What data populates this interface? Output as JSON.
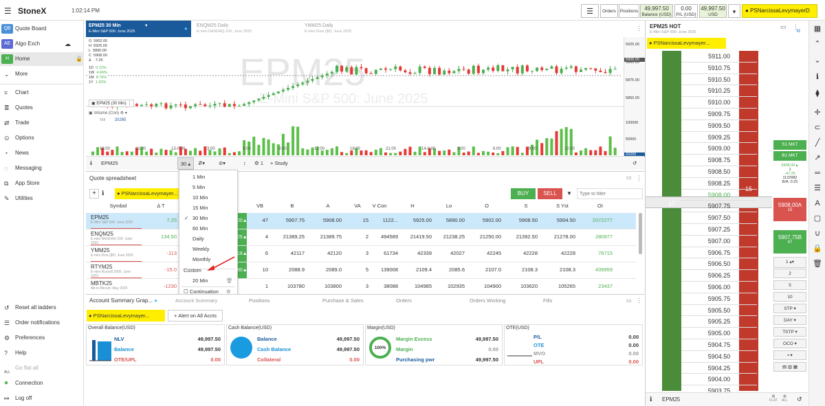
{
  "app": {
    "menu_icon": "hamburger-icon",
    "logo": "StoneX",
    "clock": "1:02:14 PM"
  },
  "account_bar": {
    "orders": "Orders",
    "positions": "Positions",
    "balance_value": "49,997.50",
    "balance_label": "Balance (USD)",
    "pl_value": "0.00",
    "pl_label": "P/L (USD)",
    "usd_value": "49,997.50",
    "usd_label": "USD",
    "account": "PSNarcissaLevymayerD"
  },
  "sidebar": {
    "items": [
      {
        "abbr": "QB",
        "label": "Quote Board",
        "color": "#4a90d9"
      },
      {
        "abbr": "AE",
        "label": "Algo Exch",
        "color": "#5b6bd6"
      },
      {
        "abbr": "H",
        "label": "Home",
        "color": "#4caf50"
      }
    ],
    "more": "More",
    "nav": [
      "Chart",
      "Quotes",
      "Trade",
      "Options",
      "News",
      "Messaging",
      "App Store",
      "Utilities"
    ],
    "bottom": [
      "Reset all ladders",
      "Order notifications",
      "Preferences",
      "Help",
      "Go flat all",
      "Connection",
      "Log off"
    ],
    "all_label": "ALL"
  },
  "chart": {
    "tabs": [
      {
        "title": "EPM25 30 Min",
        "sub": "E-Mini S&P 500: June 2025"
      },
      {
        "title": "ENQM25 Daily",
        "sub": "E-mini NASDAQ-100: June 2025"
      },
      {
        "title": "YMM25 Daily",
        "sub": "E-mini Dow ($5): June 2025"
      }
    ],
    "watermark": "EPM25",
    "watermark_sub": "E-Mini S&P 500: June 2025",
    "ohlc": {
      "O": "5902.00",
      "H": "5925.00",
      "L": "5890.00",
      "C": "5908.00",
      "chg": "7.25"
    },
    "perf": [
      {
        "k": "1D",
        "v": "0.12%"
      },
      {
        "k": "1W",
        "v": "4.66%"
      },
      {
        "k": "1M",
        "v": "8.76%"
      },
      {
        "k": "1Y",
        "v": "1.92%"
      }
    ],
    "series_label": "EPM25 (30 Min)",
    "vol_label": "Volume (Con)",
    "vol_key": "Vol",
    "vol_value": "20265",
    "price_axis": [
      "5925.00",
      "5900.00",
      "5875.00",
      "5850.00"
    ],
    "price_tag": "5908.00",
    "vol_axis": [
      "100000",
      "50000"
    ],
    "vol_tag": "20265",
    "time_axis": [
      "18:00",
      "21:00",
      "13-0:00",
      "3:00",
      "6:00",
      "9:00",
      "12:00",
      "18:00",
      "21:00",
      "14-0:00",
      "3:00",
      "6:00",
      "9:00",
      "12:00"
    ],
    "toolbar": {
      "symbol": "EPM25",
      "interval": "30",
      "study": "+ Study",
      "settings_num": "1"
    }
  },
  "quote": {
    "title": "Quote spreadsheet",
    "account": "PSNarcissaLevymayer...",
    "buy": "BUY",
    "sell": "SELL",
    "filter_placeholder": "Type to filter",
    "columns": [
      "Symbol",
      "Δ T",
      "VB",
      "B",
      "A",
      "VA",
      "V Con",
      "H",
      "Lo",
      "O",
      "S",
      "S Yst",
      "OI"
    ],
    "rows": [
      {
        "sym": "EPM25",
        "desc": "E-Mini S&P 500: June 2025",
        "dt": "7.25",
        "vb": "47",
        "b": "5907.75",
        "a": "5908.00",
        "va": "15",
        "vcon": "1122...",
        "h": "5925.00",
        "lo": "5890.00",
        "o": "5902.00",
        "s": "5908.50",
        "syst": "5904.50",
        "oi": "2072277",
        "green": "00▲"
      },
      {
        "sym": "ENQM25",
        "desc": "E-mini NASDAQ-100: June 2025",
        "dt": "134.50",
        "vb": "4",
        "b": "21389.25",
        "a": "21389.75",
        "va": "2",
        "vcon": "494589",
        "h": "21419.50",
        "lo": "21238.25",
        "o": "21250.00",
        "s": "21392.50",
        "syst": "21278.00",
        "oi": "280977",
        "green": "25▲"
      },
      {
        "sym": "YMM25",
        "desc": "E-mini Dow ($5): June 2025",
        "dt": "-113",
        "vb": "6",
        "b": "42117",
        "a": "42120",
        "va": "3",
        "vcon": "61734",
        "h": "42339",
        "lo": "42027",
        "o": "42245",
        "s": "42228",
        "syst": "42228",
        "oi": "76715",
        "green": "18▲"
      },
      {
        "sym": "RTYM25",
        "desc": "E-mini Russell 2000: June 2025",
        "dt": "-15.0",
        "vb": "10",
        "b": "2088.9",
        "a": "2089.0",
        "va": "5",
        "vcon": "139008",
        "h": "2109.4",
        "lo": "2085.6",
        "o": "2107.0",
        "s": "2108.3",
        "syst": "2108.3",
        "oi": "439959",
        "green": "80▲"
      },
      {
        "sym": "MBTK25",
        "desc": "Micro Bitcoin: May 2025",
        "dt": "-1230",
        "vb": "1",
        "b": "103780",
        "a": "103800",
        "va": "3",
        "vcon": "38088",
        "h": "104985",
        "lo": "102935",
        "o": "104900",
        "s": "103620",
        "syst": "105265",
        "oi": "23437",
        "green": ""
      }
    ]
  },
  "dropdown": {
    "items": [
      "1 Min",
      "5 Min",
      "10 Min",
      "15 Min",
      "30 Min",
      "60 Min",
      "Daily",
      "Weekly",
      "Monthly"
    ],
    "checked": "30 Min",
    "custom": "Custom",
    "custom_item": "20 Min",
    "continuation": "Continuation"
  },
  "account_summary": {
    "title": "Account Summary Grap...",
    "tabs": [
      "Account Summary",
      "Positions",
      "Purchase & Sales",
      "Orders",
      "Orders Working",
      "Fills"
    ],
    "account": "PSNarcissaLevymayer...",
    "alert": "+ Alert on All Accts",
    "cards": [
      {
        "title": "Overall Balance(USD)",
        "rows": [
          {
            "l": "NLV",
            "v": "49,997.50"
          },
          {
            "l": "Balance",
            "v": "49,997.50"
          },
          {
            "l": "OTE/UPL",
            "v": "0.00"
          }
        ]
      },
      {
        "title": "Cash Balance(USD)",
        "rows": [
          {
            "l": "Balance",
            "v": "49,997.50"
          },
          {
            "l": "Cash Balance",
            "v": "49,997.50"
          },
          {
            "l": "Collateral",
            "v": "0.00"
          }
        ]
      },
      {
        "title": "Margin(USD)",
        "gauge": "100%",
        "rows": [
          {
            "l": "Margin Excess",
            "v": "49,997.50"
          },
          {
            "l": "Margin",
            "v": "0.00"
          },
          {
            "l": "Purchasing pwr",
            "v": "49,997.50"
          }
        ]
      },
      {
        "title": "OTE(USD)",
        "rows": [
          {
            "l": "P/L",
            "v": "0.00"
          },
          {
            "l": "OTE",
            "v": "0.00"
          },
          {
            "l": "MVO",
            "v": "0.00"
          },
          {
            "l": "UPL",
            "v": "0.00"
          }
        ]
      }
    ]
  },
  "ladder": {
    "title": "EPM25 HOT",
    "sub": "E-Mini S&P 500: June 2025",
    "account": "PSNarcissaLevymayer...",
    "prices": [
      "5911.00",
      "5910.75",
      "5910.50",
      "5910.25",
      "5910.00",
      "5909.75",
      "5909.50",
      "5909.25",
      "5909.00",
      "5908.75",
      "5908.50",
      "5908.25",
      "5908.00",
      "5907.75",
      "5907.50",
      "5907.25",
      "5907.00",
      "5906.75",
      "5906.50",
      "5906.25",
      "5906.00",
      "5905.75",
      "5905.50",
      "5905.25",
      "5905.00",
      "5904.75",
      "5904.50",
      "5904.25",
      "5904.00",
      "5903.75"
    ],
    "ask_size": "15",
    "bid_size": "47",
    "last": "5908.00",
    "s1mkt": "S1 MKT",
    "b1mkt": "B1 MKT",
    "info": [
      "5908.00▲",
      "1",
      "-47.25",
      "1122982",
      "B/A: 0.25"
    ],
    "sell_btn": "5908.00A",
    "sell_sub": "15",
    "buy_btn": "5907.75B",
    "buy_sub": "47",
    "qty": "1",
    "qty_opts": [
      "2",
      "5",
      "10"
    ],
    "ordtype": "STP",
    "tif": "DAY",
    "tstp": "TSTP",
    "oco": "OCO",
    "symbol": "EPM25",
    "flat": "FLAT",
    "all": "ALL"
  },
  "colors": {
    "blue": "#1a5a9b",
    "green": "#4caf50",
    "red": "#d9534f",
    "yellow": "#ffee00"
  }
}
